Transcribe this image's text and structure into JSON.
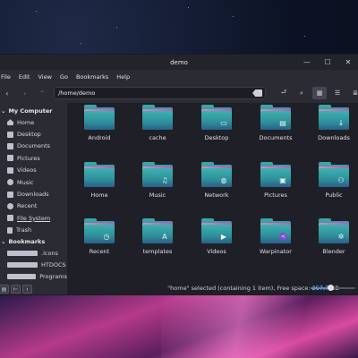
{
  "window": {
    "title": "demo",
    "controls": [
      "minimize-icon",
      "maximize-icon",
      "close-icon"
    ]
  },
  "menubar": [
    "File",
    "Edit",
    "View",
    "Go",
    "Bookmarks",
    "Help"
  ],
  "toolbar": {
    "path": "/home/demo"
  },
  "sidebar": {
    "sections": [
      {
        "heading": "My Computer",
        "items": [
          {
            "label": "Home",
            "icon": "home-icon"
          },
          {
            "label": "Desktop",
            "icon": "desktop-icon"
          },
          {
            "label": "Documents",
            "icon": "documents-icon"
          },
          {
            "label": "Pictures",
            "icon": "pictures-icon"
          },
          {
            "label": "Videos",
            "icon": "videos-icon"
          },
          {
            "label": "Music",
            "icon": "music-icon"
          },
          {
            "label": "Downloads",
            "icon": "downloads-icon"
          },
          {
            "label": "Recent",
            "icon": "recent-icon"
          },
          {
            "label": "File System",
            "icon": "filesystem-icon"
          },
          {
            "label": "Trash",
            "icon": "trash-icon"
          }
        ]
      },
      {
        "heading": "Bookmarks",
        "items": [
          {
            "label": ".icons",
            "icon": "folder-icon"
          },
          {
            "label": "HTDOCS",
            "icon": "folder-icon"
          },
          {
            "label": "Programs",
            "icon": "folder-icon"
          }
        ]
      }
    ]
  },
  "folders": [
    {
      "label": "Android",
      "glyph": ""
    },
    {
      "label": "cache",
      "glyph": ""
    },
    {
      "label": "Desktop",
      "glyph": "▭"
    },
    {
      "label": "Documents",
      "glyph": "▤"
    },
    {
      "label": "Downloads",
      "glyph": "↓"
    },
    {
      "label": "Home",
      "glyph": ""
    },
    {
      "label": "Music",
      "glyph": "♫"
    },
    {
      "label": "Network",
      "glyph": "◍"
    },
    {
      "label": "Pictures",
      "glyph": "▣"
    },
    {
      "label": "Public",
      "glyph": "⚇"
    },
    {
      "label": "Recent",
      "glyph": "◷"
    },
    {
      "label": "templates",
      "glyph": "A"
    },
    {
      "label": "Videos",
      "glyph": "▶"
    },
    {
      "label": "Warpinator",
      "glyph": "<"
    },
    {
      "label": "Blender",
      "glyph": "✲"
    }
  ],
  "status": {
    "text": "\"home\" selected (containing 1 item), Free space: 257,7 GB"
  },
  "zoom": {
    "level": 0.45
  },
  "colors": {
    "folder": "#3aa6a9",
    "accent": "#4a8fd8",
    "warpinator": "#7a4fd1"
  }
}
